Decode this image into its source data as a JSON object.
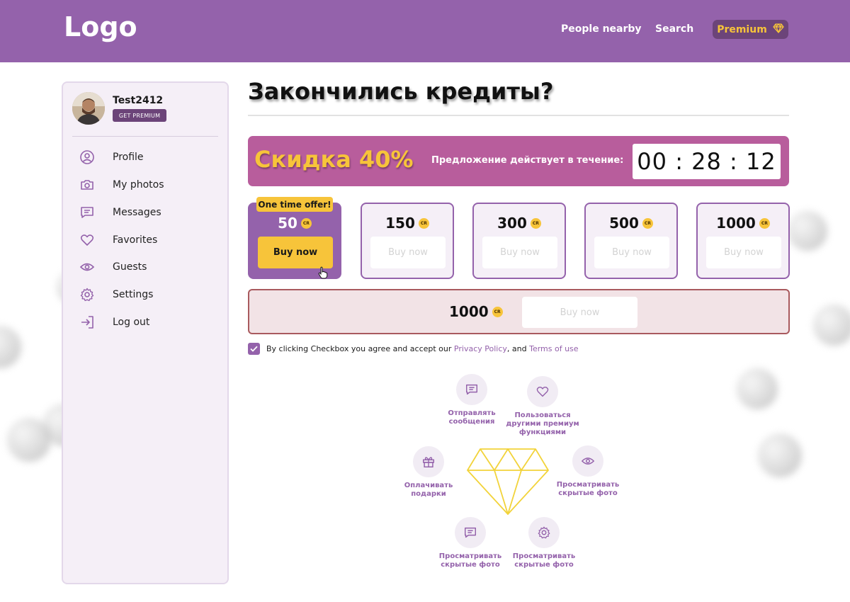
{
  "header": {
    "logo": "Logo",
    "nav": {
      "people_nearby": "People nearby",
      "search": "Search",
      "premium": "Premium"
    }
  },
  "sidebar": {
    "user": {
      "name": "Test2412",
      "get_premium": "GET PREMIUM"
    },
    "items": [
      {
        "label": "Profile",
        "icon": "user-icon"
      },
      {
        "label": "My photos",
        "icon": "camera-icon"
      },
      {
        "label": "Messages",
        "icon": "message-icon"
      },
      {
        "label": "Favorites",
        "icon": "heart-icon"
      },
      {
        "label": "Guests",
        "icon": "eye-icon"
      },
      {
        "label": "Settings",
        "icon": "gear-icon"
      },
      {
        "label": "Log out",
        "icon": "logout-icon"
      }
    ]
  },
  "main": {
    "title": "Закончились кредиты?",
    "banner": {
      "discount": "Скидка 40%",
      "offer_text": "Предложение действует в течение:",
      "timer": "00 : 28 : 12"
    },
    "credit_badge": "CR",
    "packages": [
      {
        "amount": "50",
        "buy": "Buy now",
        "tag": "One time offer!"
      },
      {
        "amount": "150",
        "buy": "Buy now"
      },
      {
        "amount": "300",
        "buy": "Buy now"
      },
      {
        "amount": "500",
        "buy": "Buy now"
      },
      {
        "amount": "1000",
        "buy": "Buy now"
      }
    ],
    "wide_package": {
      "amount": "1000",
      "buy": "Buy now"
    },
    "terms": {
      "text_before": "By clicking Checkbox you agree and accept our",
      "privacy": "Privacy Policy",
      "and": ", and",
      "terms": "Terms of use",
      "checked": true
    },
    "features": [
      {
        "label": "Отправлять сообщения",
        "icon": "message-icon"
      },
      {
        "label": "Пользоваться другими премиум функциями",
        "icon": "heart-icon"
      },
      {
        "label": "Оплачивать подарки",
        "icon": "gift-icon"
      },
      {
        "label": "Просматривать скрытые фото",
        "icon": "eye-icon"
      },
      {
        "label": "Просматривать скрытые фото",
        "icon": "message-icon"
      },
      {
        "label": "Просматривать скрытые фото",
        "icon": "gear-icon"
      }
    ]
  },
  "colors": {
    "brand": "#9462ab",
    "accent": "#f7c43a",
    "banner": "#b85d9c",
    "dark_purple": "#6c4479"
  }
}
